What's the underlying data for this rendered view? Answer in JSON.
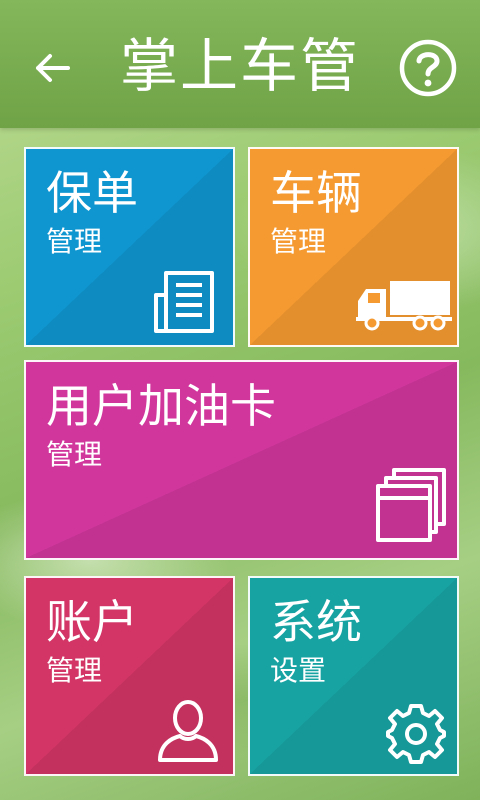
{
  "header": {
    "title": "掌上车管",
    "back_icon": "arrow-left-icon",
    "help_icon": "question-circle-icon"
  },
  "tiles": [
    {
      "id": "policy",
      "title": "保单",
      "subtitle": "管理",
      "icon": "document-icon",
      "color": "#0f96d0"
    },
    {
      "id": "vehicle",
      "title": "车辆",
      "subtitle": "管理",
      "icon": "truck-icon",
      "color": "#f49a30"
    },
    {
      "id": "card",
      "title": "用户加油卡",
      "subtitle": "管理",
      "icon": "card-stack-icon",
      "color": "#d0369c"
    },
    {
      "id": "account",
      "title": "账户",
      "subtitle": "管理",
      "icon": "user-icon",
      "color": "#d23566"
    },
    {
      "id": "system",
      "title": "系统",
      "subtitle": "设置",
      "icon": "gear-icon",
      "color": "#18a3a3"
    }
  ]
}
